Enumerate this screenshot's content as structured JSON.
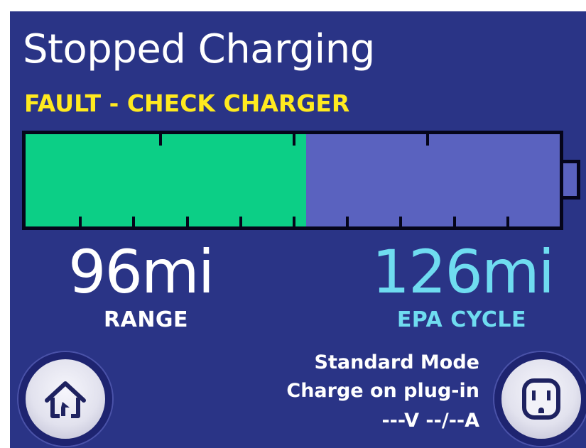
{
  "status": {
    "title": "Stopped Charging",
    "fault": "FAULT - CHECK CHARGER"
  },
  "battery": {
    "charge_fraction": 0.525,
    "colors": {
      "charged": "#0ccf86",
      "empty": "#5a62bf"
    }
  },
  "range": {
    "value": "96mi",
    "label": "RANGE"
  },
  "epa": {
    "value": "126mi",
    "label": "EPA CYCLE"
  },
  "charging": {
    "mode": "Standard Mode",
    "schedule": "Charge on plug-in",
    "electrical": "---V --/--A"
  },
  "buttons": {
    "home_icon": "home-icon",
    "outlet_icon": "outlet-icon"
  },
  "theme": {
    "background": "#2a3486",
    "fault_color": "#ffea1f",
    "epa_color": "#6fdcf0"
  }
}
